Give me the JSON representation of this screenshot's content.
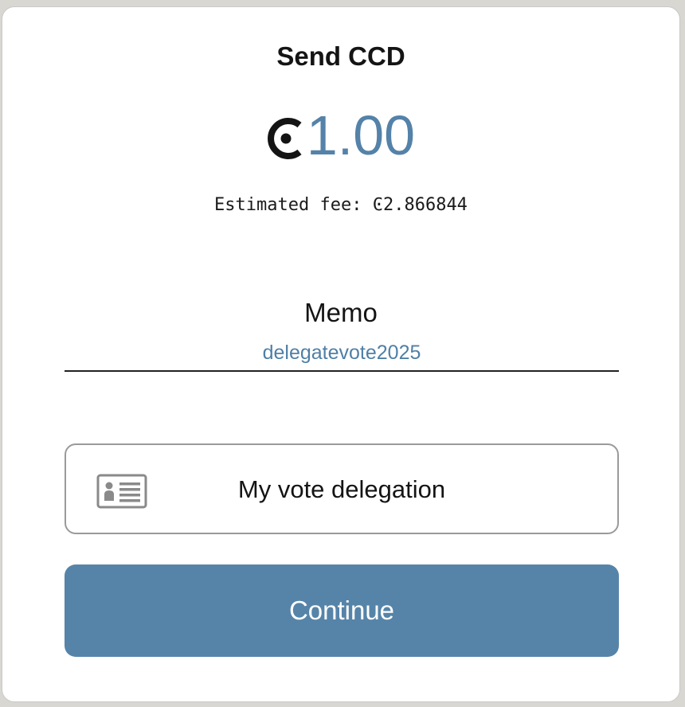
{
  "dialog": {
    "title": "Send CCD",
    "amount": "1.00",
    "currency_icon": "ccd-icon",
    "fee_label": "Estimated fee: Ͼ2.866844",
    "memo_label": "Memo",
    "memo_value": "delegatevote2025",
    "identity_button_label": "My vote delegation",
    "identity_icon": "id-card-icon",
    "continue_label": "Continue",
    "colors": {
      "accent": "#5684a9",
      "amount_text": "#5482a8",
      "memo_text": "#4f7fa6"
    }
  }
}
